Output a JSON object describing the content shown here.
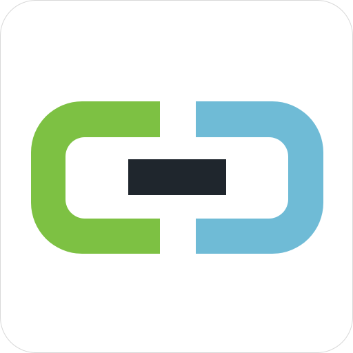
{
  "icon": {
    "name": "link-icon",
    "colors": {
      "background": "#ffffff",
      "border": "#d8d8d8",
      "left_link": "#7dc143",
      "right_link": "#6fbbd6",
      "center_bar": "#1f262d"
    }
  }
}
